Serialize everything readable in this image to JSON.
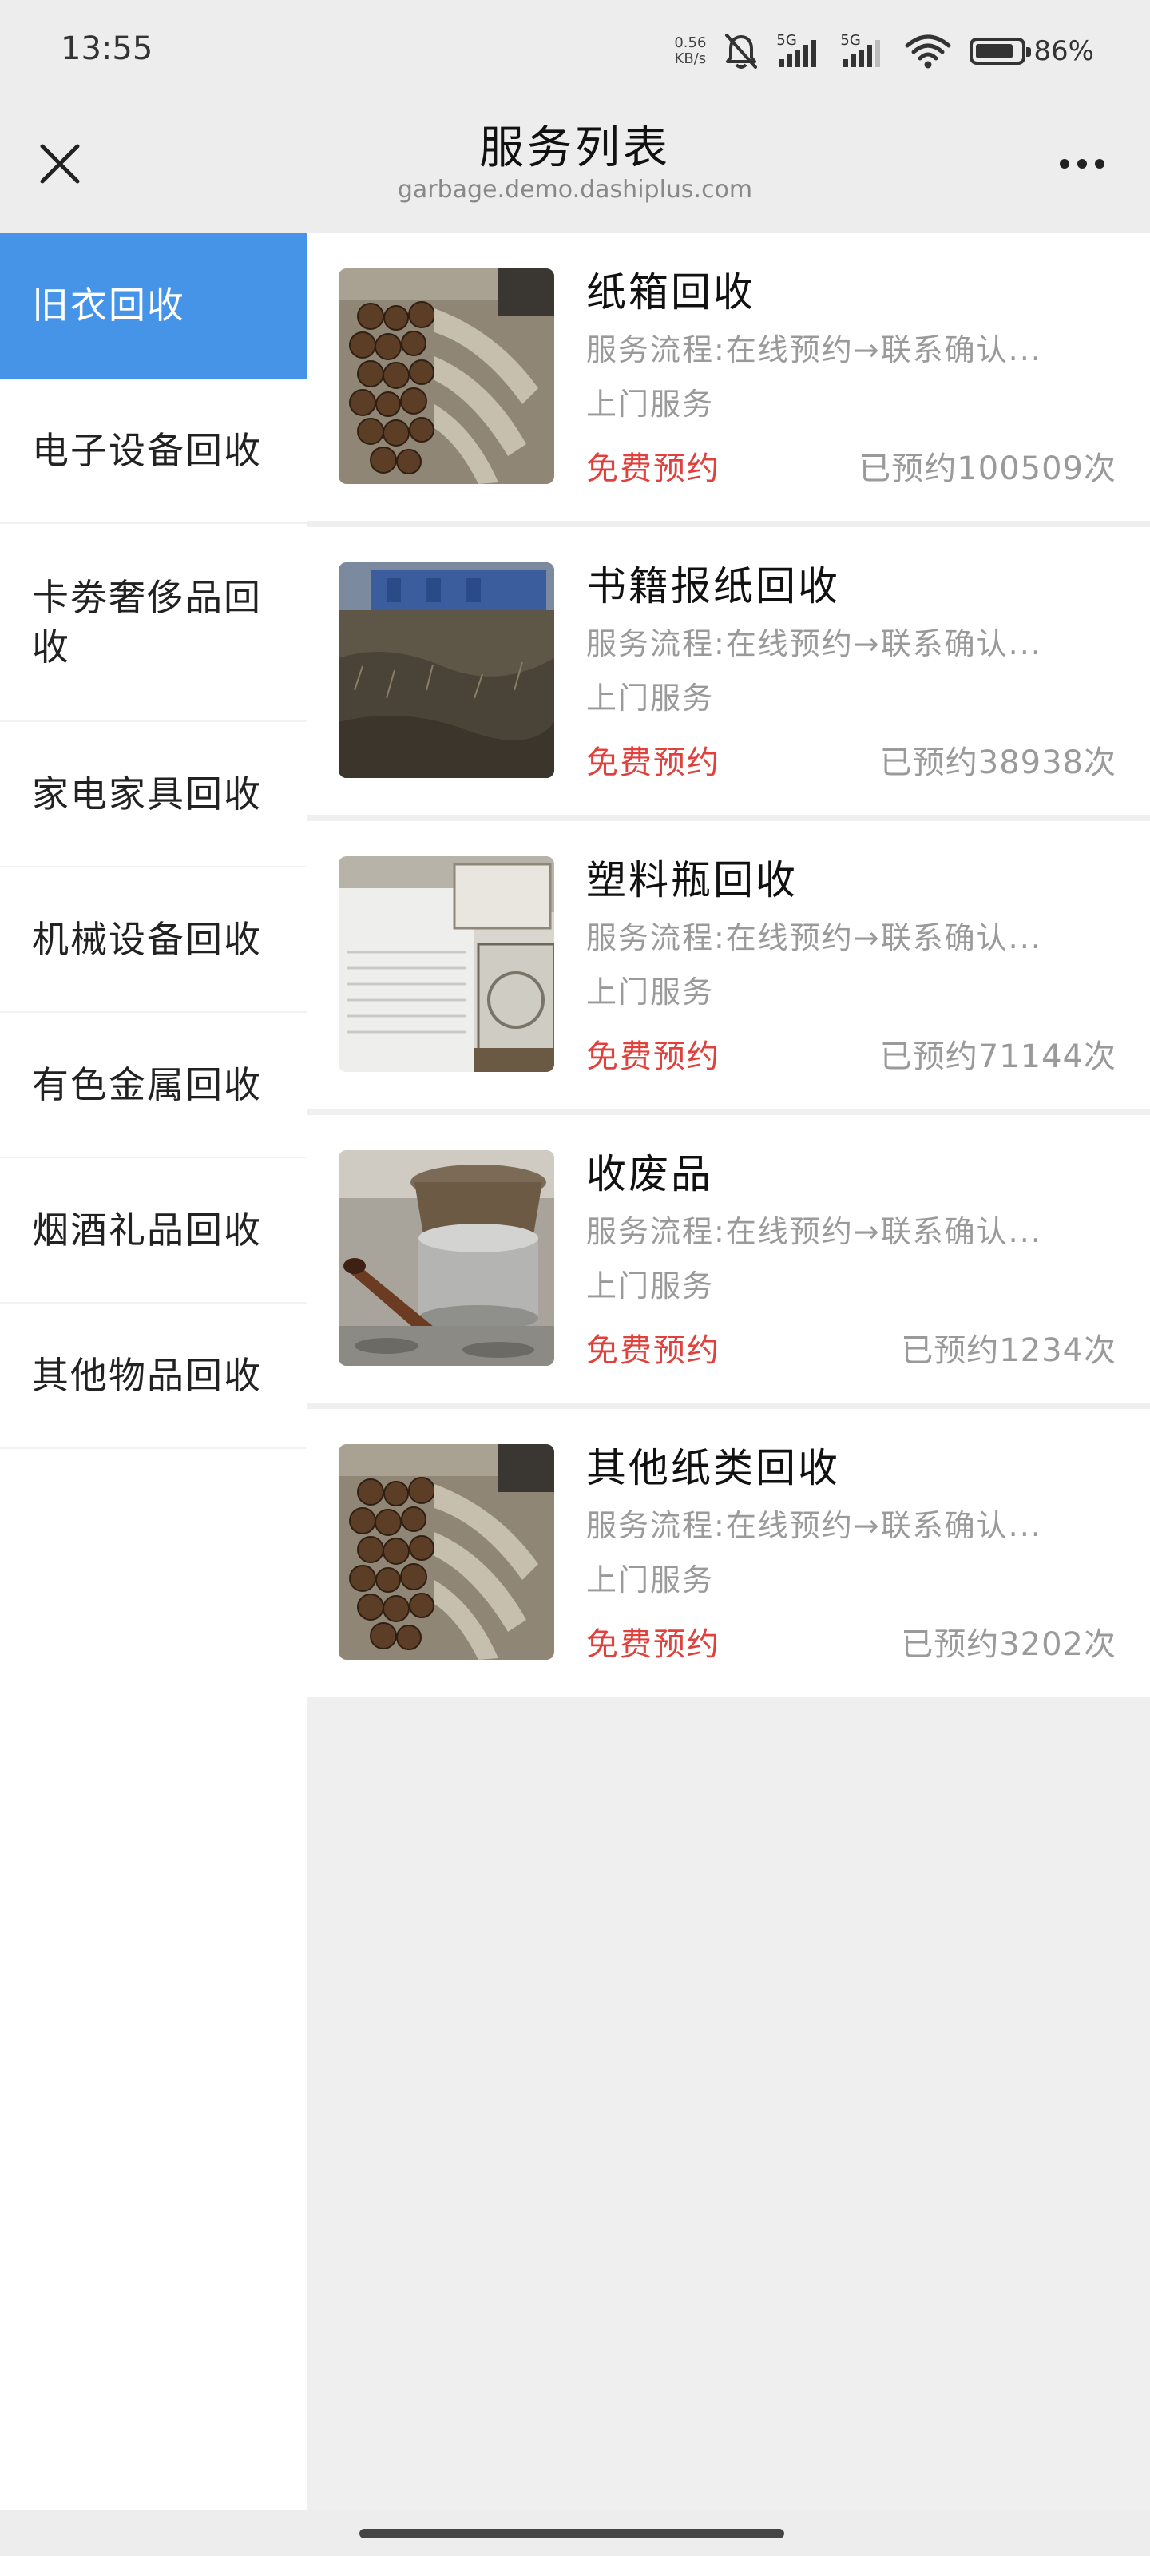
{
  "status_bar": {
    "time": "13:55",
    "net_speed_value": "0.56",
    "net_speed_unit": "KB/s",
    "signal_1_label": "5G",
    "signal_2_label": "5G",
    "battery_text": "86%",
    "battery_level": 0.86,
    "icons": [
      "bell-muted-icon",
      "signal-icon",
      "signal-icon",
      "wifi-icon",
      "battery-icon"
    ]
  },
  "header": {
    "title": "服务列表",
    "url": "garbage.demo.dashiplus.com",
    "close_icon": "close-icon",
    "more_icon": "more-icon"
  },
  "sidebar": {
    "items": [
      {
        "label": "旧衣回收",
        "active": true
      },
      {
        "label": "电子设备回收",
        "active": false
      },
      {
        "label": "卡劵奢侈品回收",
        "active": false
      },
      {
        "label": "家电家具回收",
        "active": false
      },
      {
        "label": "机械设备回收",
        "active": false
      },
      {
        "label": "有色金属回收",
        "active": false
      },
      {
        "label": "烟酒礼品回收",
        "active": false
      },
      {
        "label": "其他物品回收",
        "active": false
      }
    ]
  },
  "services": [
    {
      "title": "纸箱回收",
      "desc_line1": "服务流程:在线预约→联系确认...",
      "desc_line2": "上门服务",
      "cta": "免费预约",
      "count": "已预约100509次",
      "thumb": "logs"
    },
    {
      "title": "书籍报纸回收",
      "desc_line1": "服务流程:在线预约→联系确认...",
      "desc_line2": "上门服务",
      "cta": "免费预约",
      "count": "已预约38938次",
      "thumb": "field"
    },
    {
      "title": "塑料瓶回收",
      "desc_line1": "服务流程:在线预约→联系确认...",
      "desc_line2": "上门服务",
      "cta": "免费预约",
      "count": "已预约71144次",
      "thumb": "ac-units"
    },
    {
      "title": "收废品",
      "desc_line1": "服务流程:在线预约→联系确认...",
      "desc_line2": "上门服务",
      "cta": "免费预约",
      "count": "已预约1234次",
      "thumb": "scrap-metal"
    },
    {
      "title": "其他纸类回收",
      "desc_line1": "服务流程:在线预约→联系确认...",
      "desc_line2": "上门服务",
      "cta": "免费预约",
      "count": "已预约3202次",
      "thumb": "logs"
    }
  ],
  "colors": {
    "accent": "#4594e8",
    "cta": "#e0413c",
    "muted": "#9a9a9a"
  }
}
